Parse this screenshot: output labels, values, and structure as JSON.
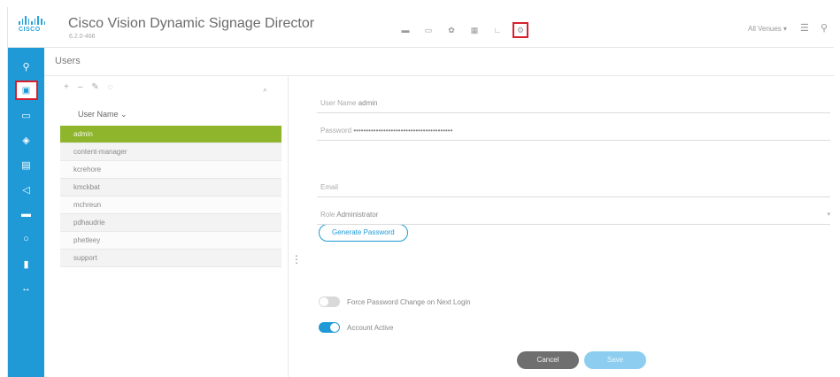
{
  "header": {
    "logo_text": "CISCO",
    "app_title": "Cisco Vision Dynamic Signage Director",
    "version": "6.2.0-466",
    "top_icons": [
      "folder-icon",
      "display-icon",
      "gear-icon",
      "grid-icon",
      "chart-icon",
      "settings-icon"
    ],
    "venues_label": "All Venues",
    "menu_glyph": "☰",
    "user_glyph": "⚲"
  },
  "sidebar": {
    "items": [
      "location-icon",
      "users-icon",
      "monitor-icon",
      "channel-icon",
      "screen-icon",
      "audio-icon",
      "card-icon",
      "circle-icon",
      "phone-icon",
      "more-icon"
    ]
  },
  "page": {
    "title": "Users"
  },
  "list": {
    "toolbar": [
      "+",
      "–",
      "✎",
      "◌"
    ],
    "column_header": "User Name ⌄",
    "rows": [
      "admin",
      "content-manager",
      "kcrehore",
      "kmckbat",
      "mchreun",
      "pdhaudrie",
      "phetleey",
      "support"
    ],
    "selected_index": 0
  },
  "form": {
    "username_label": "User Name",
    "username_value": "admin",
    "password_label": "Password",
    "password_value": "••••••••••••••••••••••••••••••••••••••••",
    "generate_button": "Generate Password",
    "email_label": "Email",
    "role_label": "Role",
    "role_value": "Administrator",
    "force_change_label": "Force Password Change on Next Login",
    "force_change_on": false,
    "account_active_label": "Account Active",
    "account_active_on": true,
    "cancel_button": "Cancel",
    "save_button": "Save"
  },
  "colors": {
    "accent": "#1f9ad6",
    "selected_row": "#8eb52c",
    "highlight_box": "#d6202e"
  }
}
